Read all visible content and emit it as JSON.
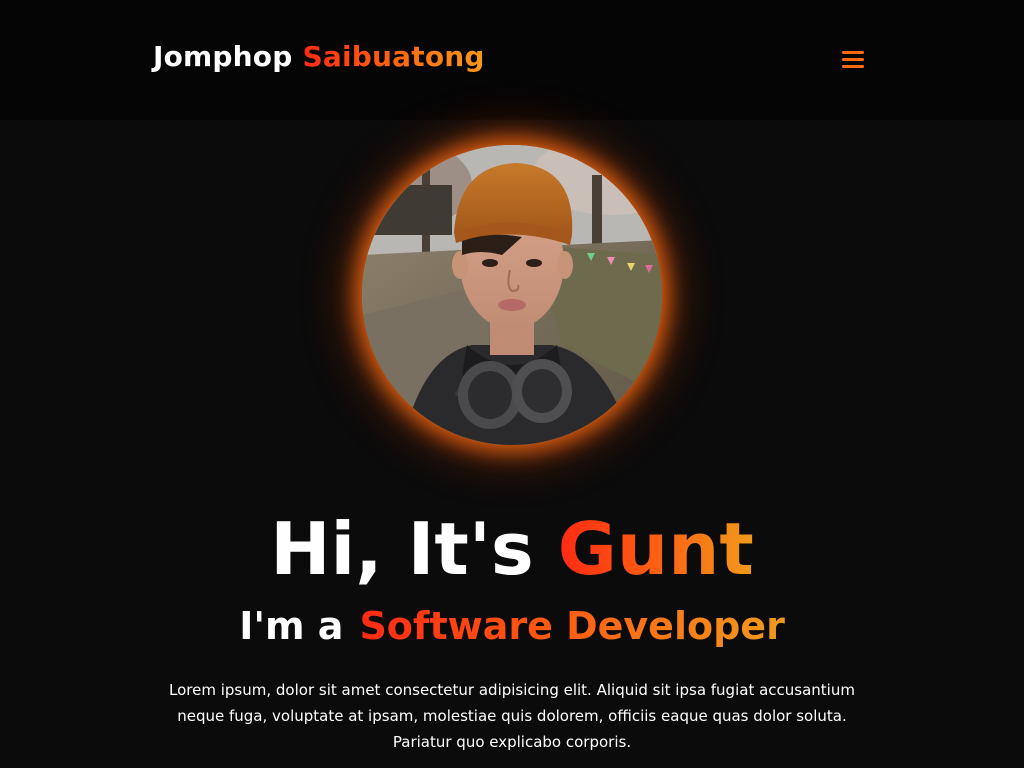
{
  "header": {
    "first_name": "Jomphop",
    "last_name": "Saibuatong",
    "menu_icon": "hamburger-menu-icon"
  },
  "hero": {
    "greeting": "Hi, It's",
    "name": "Gunt",
    "role_prefix": "I'm a",
    "role": "Software Developer",
    "description": "Lorem ipsum, dolor sit amet consectetur adipisicing elit. Aliquid sit ipsa fugiat accusantium neque fuga, voluptate at ipsam, molestiae quis dolorem, officiis eaque quas dolor soluta. Pariatur quo explicabo corporis."
  },
  "colors": {
    "background": "#0b0b0b",
    "header_background": "#050505",
    "accent_start": "#ff2a14",
    "accent_mid": "#ff6a10",
    "accent_end": "#f59a1a",
    "text": "#ffffff"
  }
}
